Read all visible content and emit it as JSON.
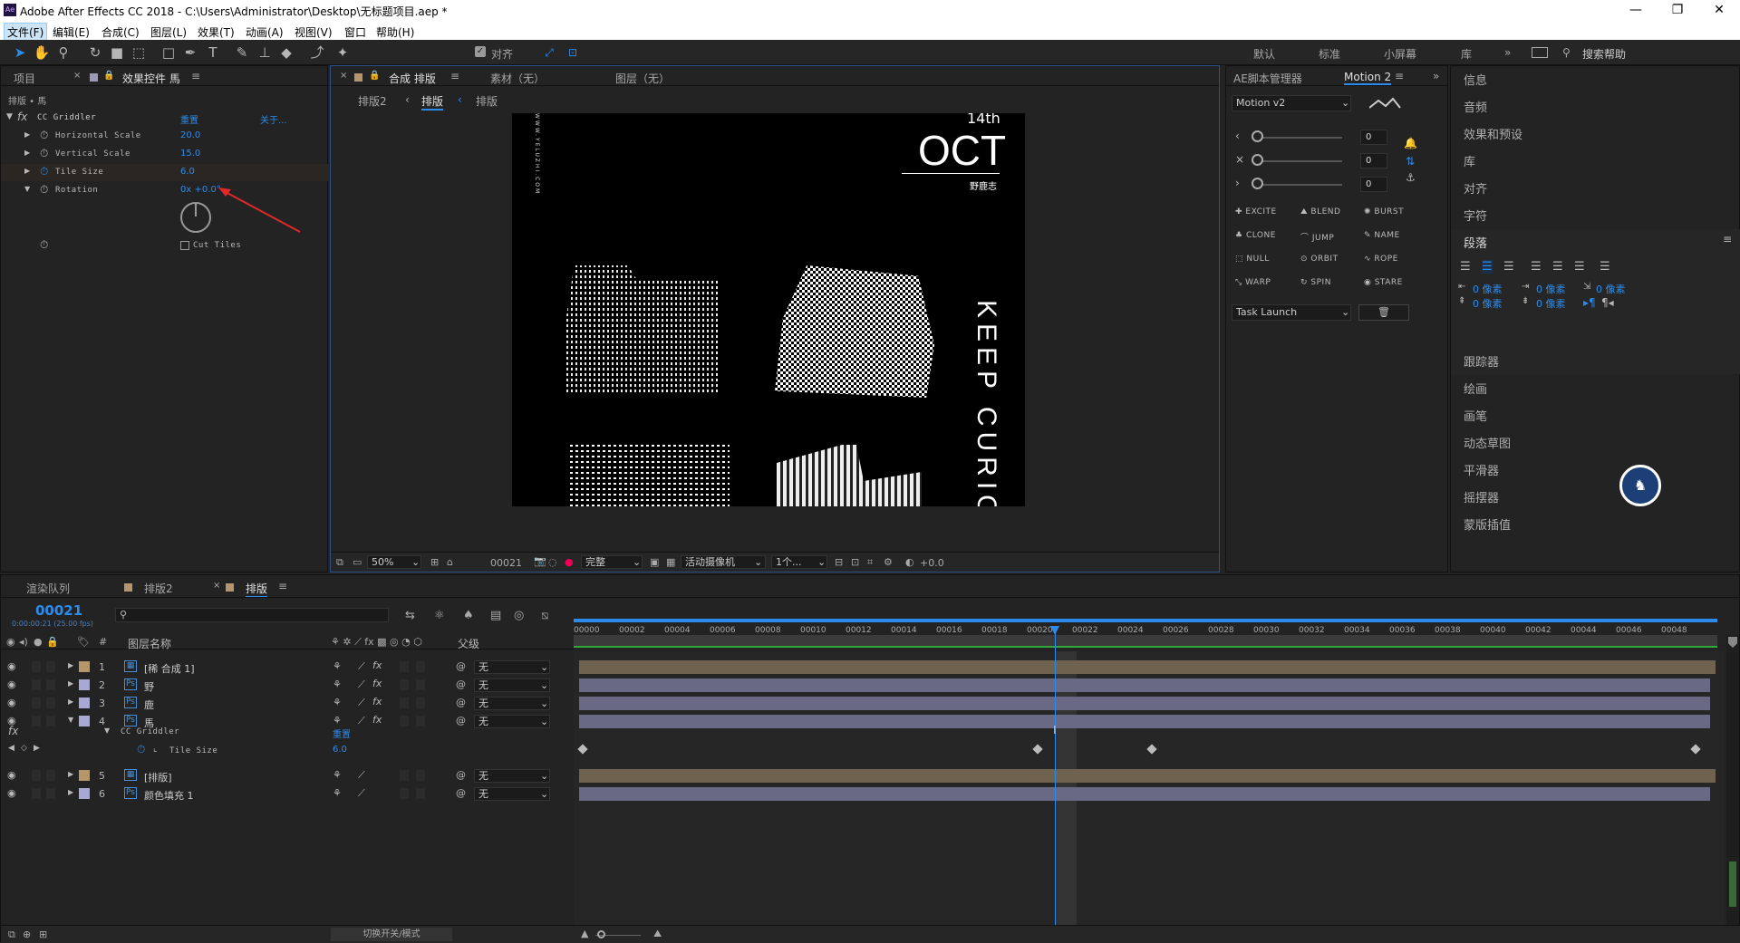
{
  "app": {
    "title": "Adobe After Effects CC 2018 - C:\\Users\\Administrator\\Desktop\\无标题项目.aep *",
    "logo": "Ae"
  },
  "menu": [
    "文件(F)",
    "编辑(E)",
    "合成(C)",
    "图层(L)",
    "效果(T)",
    "动画(A)",
    "视图(V)",
    "窗口",
    "帮助(H)"
  ],
  "toolbar": {
    "align_label": "对齐",
    "workspaces": [
      "默认",
      "标准",
      "小屏幕",
      "库"
    ],
    "search_placeholder": "搜索帮助"
  },
  "effects_panel": {
    "tabs": [
      "项目",
      "效果控件 馬"
    ],
    "breadcrumb": "排版 • 馬",
    "effect_name": "CC Griddler",
    "reset": "重置",
    "about": "关于...",
    "props": [
      {
        "name": "Horizontal Scale",
        "value": "20.0"
      },
      {
        "name": "Vertical Scale",
        "value": "15.0"
      },
      {
        "name": "Tile Size",
        "value": "6.0"
      },
      {
        "name": "Rotation",
        "value": "0x +0.0°"
      }
    ],
    "cut_tiles": "Cut Tiles"
  },
  "comp_panel": {
    "tabs": [
      "合成 排版",
      "素材（无）",
      "图层（无）"
    ],
    "sub_tabs": [
      "排版2",
      "排版"
    ],
    "zoom": "50%",
    "timecode": "00021",
    "quality": "完整",
    "camera": "活动摄像机",
    "views": "1个...",
    "exposure": "+0.0"
  },
  "artwork": {
    "date_sup": "14th",
    "month": "OCT",
    "brand": "野鹿志",
    "vertical_text": "KEEP CURIOSI",
    "side_url": "WWW.YELUZHI.COM"
  },
  "script_panel": {
    "tabs": [
      "AE脚本管理器",
      "Motion 2"
    ],
    "preset": "Motion v2",
    "slider_values": [
      "0",
      "0",
      "0"
    ],
    "buttons": [
      "EXCITE",
      "BLEND",
      "BURST",
      "CLONE",
      "JUMP",
      "NAME",
      "NULL",
      "ORBIT",
      "ROPE",
      "WARP",
      "SPIN",
      "STARE"
    ],
    "task": "Task Launch"
  },
  "right_panels": {
    "items_top": [
      "信息",
      "音频",
      "效果和预设",
      "库",
      "对齐",
      "字符"
    ],
    "paragraph": "段落",
    "para_values": [
      "0 像素",
      "0 像素",
      "0 像素",
      "0 像素",
      "0 像素"
    ],
    "items_bottom": [
      "跟踪器",
      "绘画",
      "画笔",
      "动态草图",
      "平滑器",
      "摇摆器",
      "蒙版插值"
    ]
  },
  "timeline": {
    "tabs": [
      "渲染队列",
      "排版2",
      "排版"
    ],
    "timecode": "00021",
    "timecode_sub": "0:00:00:21 (25.00 fps)",
    "columns": {
      "name": "图层名称",
      "parent": "父级"
    },
    "layers": [
      {
        "num": "1",
        "name": "[稀 合成 1]",
        "parent": "无",
        "color": "#b5956b"
      },
      {
        "num": "2",
        "name": "野",
        "parent": "无",
        "color": "#a9a7d4"
      },
      {
        "num": "3",
        "name": "鹿",
        "parent": "无",
        "color": "#a9a7d4"
      },
      {
        "num": "4",
        "name": "馬",
        "parent": "无",
        "color": "#a9a7d4"
      },
      {
        "num": "5",
        "name": "[排版]",
        "parent": "无",
        "color": "#b5956b"
      },
      {
        "num": "6",
        "name": "颜色填充 1",
        "parent": "无",
        "color": "#a9a7d4"
      }
    ],
    "effect_row": {
      "name": "CC Griddler",
      "reset": "重置"
    },
    "prop_row": {
      "name": "Tile Size",
      "value": "6.0"
    },
    "ruler": [
      "00000",
      "00002",
      "00004",
      "00006",
      "00008",
      "00010",
      "00012",
      "00014",
      "00016",
      "00018",
      "00020",
      "00022",
      "00024",
      "00026",
      "00028",
      "00030",
      "00032",
      "00034",
      "00036",
      "00038",
      "00040",
      "00042",
      "00044",
      "00046",
      "00048"
    ],
    "toggle_label": "切换开关/模式"
  },
  "colors": {
    "accent": "#2d8ceb",
    "bar_comp": "#6f6350",
    "bar_layer": "#6a6985",
    "arrow": "#e0282a"
  }
}
